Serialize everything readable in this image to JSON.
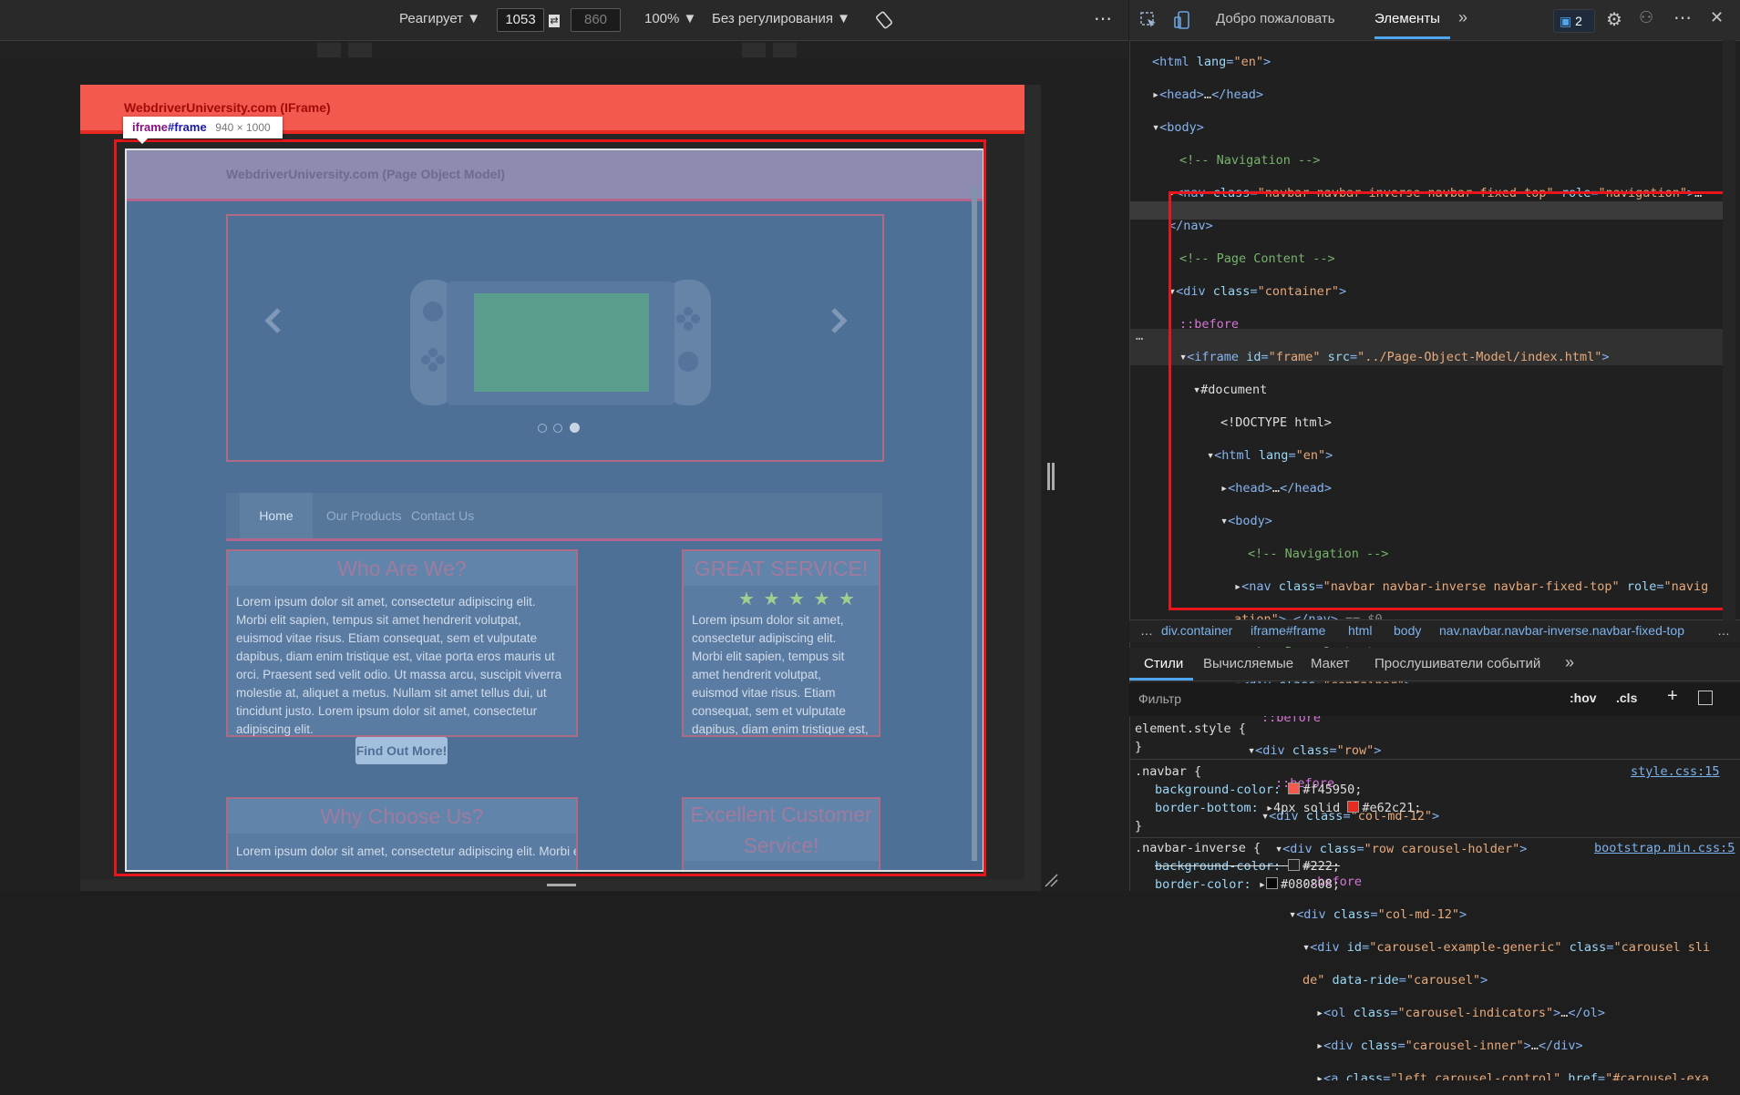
{
  "device_toolbar": {
    "device": "Реагирует",
    "width": "1053",
    "height": "860",
    "zoom": "100%",
    "throttling": "Без регулирования",
    "more": "⋮"
  },
  "outer_page": {
    "brand": "WebdriverUniversity.com (IFrame)"
  },
  "tooltip": {
    "element": "iframe",
    "id": "#frame",
    "size": "940 × 1000"
  },
  "frame": {
    "brand": "WebdriverUniversity.com (Page Object Model)",
    "menu": [
      "Home",
      "Our Products",
      "Contact Us"
    ],
    "card1": {
      "title": "Who Are We?",
      "body": "Lorem ipsum dolor sit amet, consectetur adipiscing elit. Morbi elit sapien, tempus sit amet hendrerit volutpat, euismod vitae risus. Etiam consequat, sem et vulputate dapibus, diam enim tristique est, vitae porta eros mauris ut orci. Praesent sed velit odio. Ut massa arcu, suscipit viverra molestie at, aliquet a metus. Nullam sit amet tellus dui, ut tincidunt justo. Lorem ipsum dolor sit amet, consectetur adipiscing elit.",
      "button": "Find Out More!"
    },
    "card2": {
      "title": "GREAT SERVICE!",
      "stars": "★ ★ ★ ★ ★",
      "body": "Lorem ipsum dolor sit amet, consectetur adipiscing elit. Morbi elit sapien, tempus sit amet hendrerit volutpat, euismod vitae risus. Etiam consequat, sem et vulputate dapibus, diam enim tristique est, vitae porta eros mauris ut orci."
    },
    "card3": {
      "title": "Why Choose Us?",
      "body": "Lorem ipsum dolor sit amet, consectetur adipiscing elit. Morbi elit"
    },
    "card4": {
      "title": "Excellent Customer Service!"
    }
  },
  "devtools": {
    "tabs": [
      "Добро пожаловать",
      "Элементы"
    ],
    "active_tab": "Элементы",
    "issues_count": "2",
    "breadcrumbs": [
      "…",
      "div.container",
      "iframe#frame",
      "html",
      "body",
      "nav.navbar.navbar-inverse.navbar-fixed-top",
      "…"
    ],
    "styles_tabs": [
      "Стили",
      "Вычисляемые",
      "Макет",
      "Прослушиватели событий"
    ],
    "filter_placeholder": "Фильтр",
    "hov": ":hov",
    "cls": ".cls",
    "rules": {
      "element_style": "element.style {",
      "close": "}",
      "navbar_selector": ".navbar {",
      "navbar_source": "style.css:15",
      "bg_prop": "background-color:",
      "bg_val": "#f45950;",
      "border_prop": "border-bottom:",
      "border_val": "4px solid",
      "border_color": "#e62c21;",
      "inverse_selector": ".navbar-inverse {",
      "inverse_source": "bootstrap.min.css:5",
      "inv_bg_val": "#222;",
      "inv_border_prop": "border-color:",
      "inv_border_val": "#080808;"
    },
    "colors": {
      "navbar_bg": "#f45950",
      "navbar_border": "#e62c21",
      "inverse_bg": "#222",
      "inverse_border": "#080808"
    }
  }
}
